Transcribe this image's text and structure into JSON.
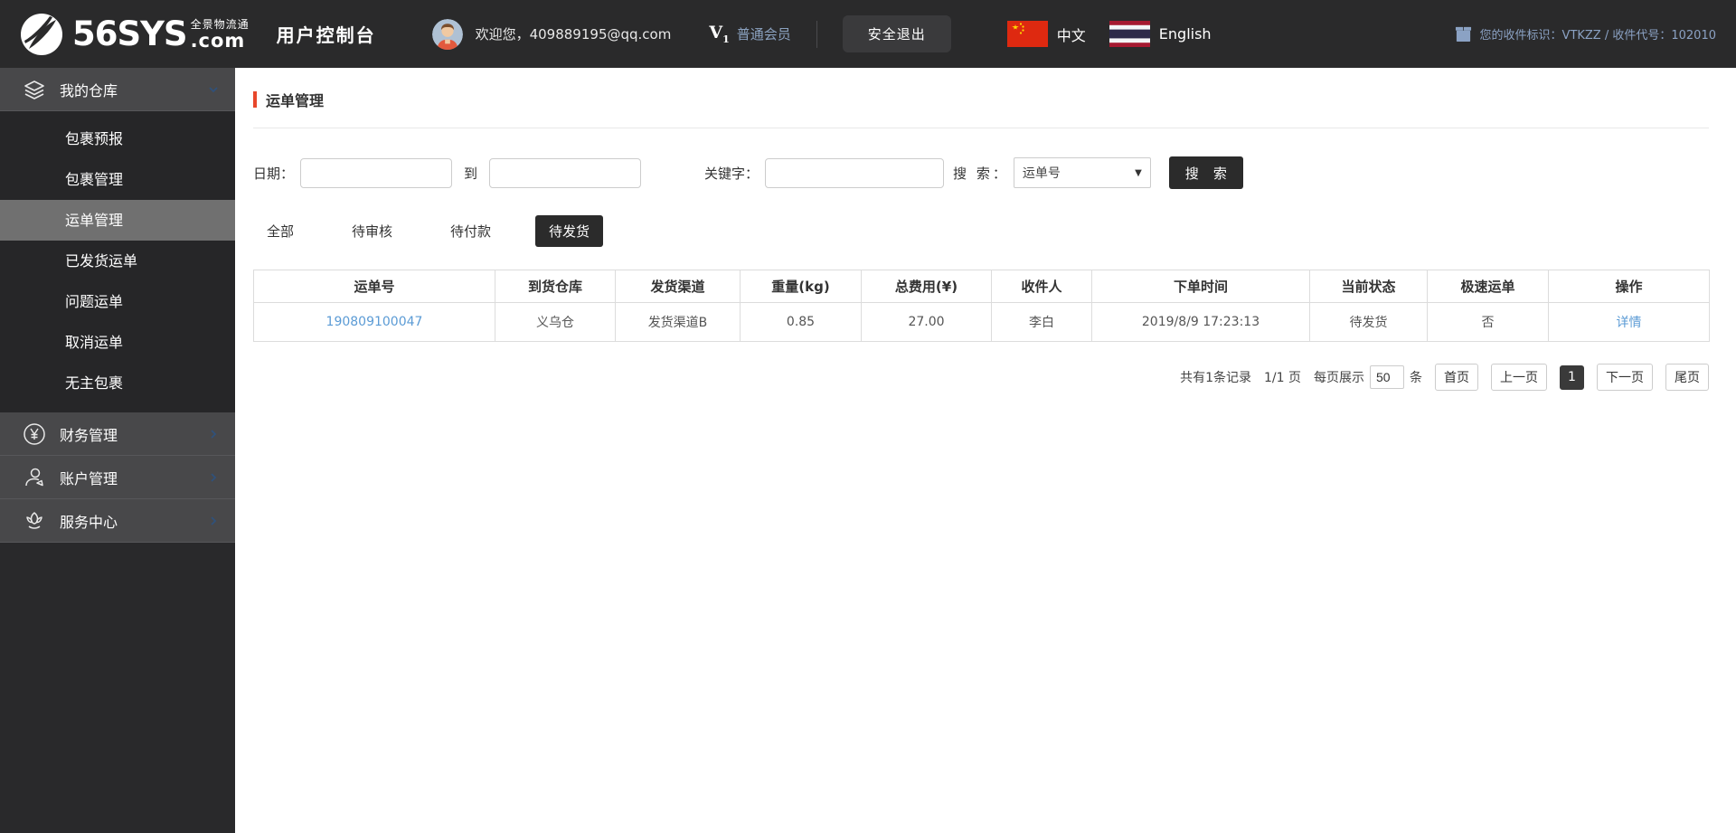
{
  "colors": {
    "accent_red": "#e8472b",
    "link_blue": "#5b9bd5",
    "header_bg": "#2a2a2b",
    "sidebar_section_bg": "#48484a",
    "sidebar_active_bg": "#707070",
    "dark_button": "#2b2b2b",
    "muted_blue_text": "#8ba2c4"
  },
  "header": {
    "logo": {
      "brand": "56SYS",
      "tagline": "全景物流通",
      "tld": ".com"
    },
    "console_title": "用户控制台",
    "welcome": "欢迎您，409889195@qq.com",
    "membership": {
      "badge_v": "V",
      "badge_level": "1",
      "label": "普通会员"
    },
    "logout_label": "安全退出",
    "lang_zh": "中文",
    "lang_en": "English",
    "receiver_info": "您的收件标识：VTKZZ / 收件代号：102010"
  },
  "sidebar": {
    "sections": [
      {
        "label": "我的仓库",
        "icon": "layers-icon",
        "expanded": true,
        "items": [
          {
            "label": "包裹预报",
            "active": false
          },
          {
            "label": "包裹管理",
            "active": false
          },
          {
            "label": "运单管理",
            "active": true
          },
          {
            "label": "已发货运单",
            "active": false
          },
          {
            "label": "问题运单",
            "active": false
          },
          {
            "label": "取消运单",
            "active": false
          },
          {
            "label": "无主包裹",
            "active": false
          }
        ]
      },
      {
        "label": "财务管理",
        "icon": "yen-circle-icon",
        "expanded": false,
        "items": []
      },
      {
        "label": "账户管理",
        "icon": "person-icon",
        "expanded": false,
        "items": []
      },
      {
        "label": "服务中心",
        "icon": "lotus-icon",
        "expanded": false,
        "items": []
      }
    ]
  },
  "main": {
    "page_title": "运单管理",
    "filters": {
      "date_label": "日期：",
      "to_label": "到",
      "keyword_label": "关键字：",
      "search_label": "搜 索：",
      "search_type_selected": "运单号",
      "search_button": "搜 索"
    },
    "tabs": [
      {
        "label": "全部",
        "active": false
      },
      {
        "label": "待审核",
        "active": false
      },
      {
        "label": "待付款",
        "active": false
      },
      {
        "label": "待发货",
        "active": true
      }
    ],
    "table": {
      "columns": [
        "运单号",
        "到货仓库",
        "发货渠道",
        "重量(kg)",
        "总费用(¥)",
        "收件人",
        "下单时间",
        "当前状态",
        "极速运单",
        "操作"
      ],
      "rows": [
        {
          "waybill_no": "190809100047",
          "warehouse": "义乌仓",
          "channel": "发货渠道B",
          "weight": "0.85",
          "total_fee": "27.00",
          "receiver": "李白",
          "order_time": "2019/8/9 17:23:13",
          "status": "待发货",
          "express": "否",
          "action": "详情"
        }
      ]
    },
    "pagination": {
      "summary": "共有1条记录",
      "page_info": "1/1 页",
      "per_page_prefix": "每页展示",
      "per_page_value": "50",
      "per_page_suffix": "条",
      "first": "首页",
      "prev": "上一页",
      "current": "1",
      "next": "下一页",
      "last": "尾页"
    }
  }
}
